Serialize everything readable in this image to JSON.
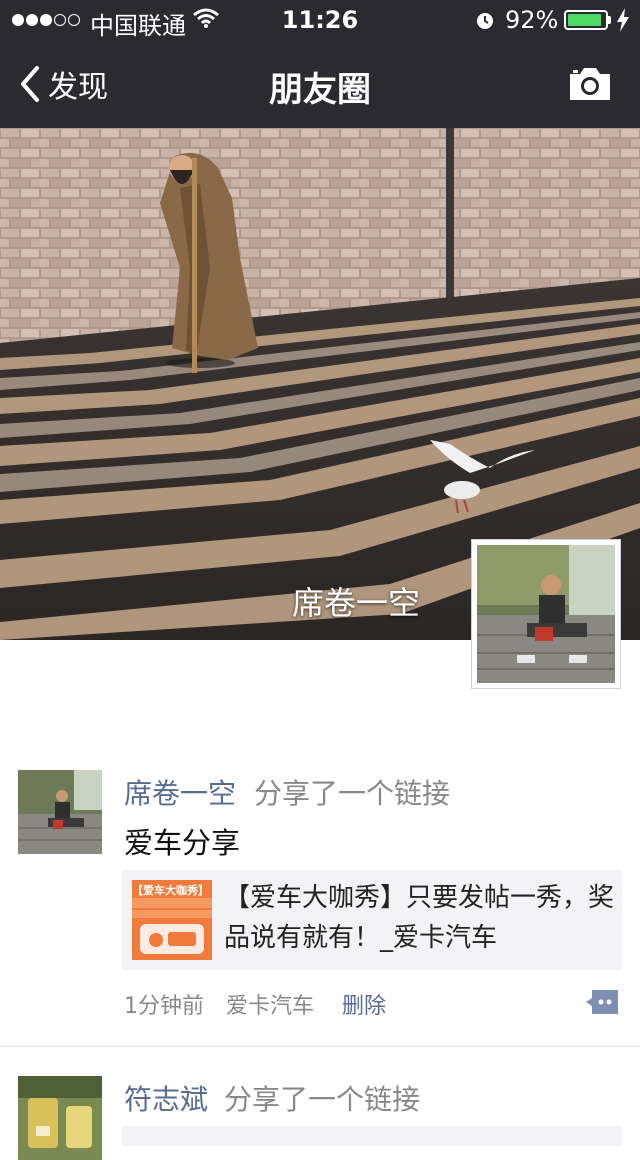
{
  "status_bar": {
    "carrier": "中国联通",
    "time": "11:26",
    "battery_percent": "92%",
    "battery_level": 0.92,
    "signal_bars_filled": 3,
    "signal_bars_total": 5
  },
  "nav": {
    "back_label": "发现",
    "title": "朋友圈",
    "camera_icon": "camera-icon"
  },
  "cover": {
    "name": "席卷一空"
  },
  "posts": [
    {
      "author": "席卷一空",
      "action": "分享了一个链接",
      "text": "爱车分享",
      "link": {
        "thumb_text": "【爱车大咖秀】",
        "title": "【爱车大咖秀】只要发帖一秀，奖品说有就有！_爱卡汽车"
      },
      "time": "1分钟前",
      "source": "爱卡汽车",
      "delete_label": "删除"
    },
    {
      "author": "符志斌",
      "action": "分享了一个链接"
    }
  ],
  "colors": {
    "nav_bg": "#2b2a30",
    "name_blue": "#576b95",
    "battery_green": "#4cd964",
    "link_bg": "#f3f3f5"
  }
}
